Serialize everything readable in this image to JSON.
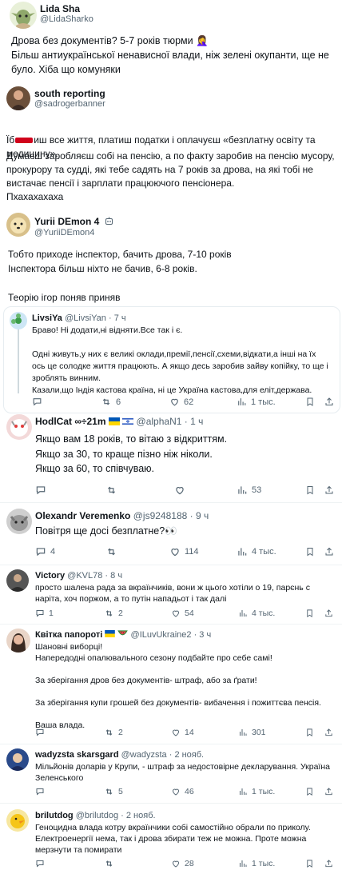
{
  "main_tweet": {
    "author_name": "Lida Sha",
    "author_handle": "@LidaSharko",
    "text": "Дрова без документів? 5-7 років тюрми 🤦‍♀️\nБільш антиукраїнської ненависної влади, ніж зелені окупанти, ще не було. Хіба що комуняки"
  },
  "quote_1": {
    "author_name": "south reporting",
    "author_handle": "@sadrogerbanner",
    "text_prefix": "Їб",
    "text_after_redact": "иш все життя, платиш податки і оплачуєш «безплатну освіту та медицину».",
    "text_rest": "Думаєш заробляєш собі на пенсію, а по факту заробив на пенсію мусору, прокурору та судді, які тебе садять на 7 років за дрова, на які тобі не вистачає пенсії і зарплати працюючого пенсіонера.\nПхахахахаха"
  },
  "quote_2": {
    "author_name": "Yurii DEmon 4",
    "author_handle": "@YuriiDEmon4",
    "text": "Тобто приходе інспектор, бачить дрова, 7-10 років\nІнспектора більш ніхто не бачив, 6-8 років.\n\nТеорію ігор поняв приняв"
  },
  "replies": [
    {
      "author_name": "LivsiYa",
      "author_handle": "@LivsiYan",
      "time": "· 7 ч",
      "text": "Браво! Ні додати,ні відняти.Все так і є.\n\nОдні живуть,у них є великі оклади,премії,пенсії,схеми,відкати,а інші на їх ось це солодке життя працюють. А якщо десь заробив зайву копійку, то ще і зроблять винним.\nКазали,що Індія кастова країна, ні це Україна кастова,для еліт,держава.",
      "reply_count": "",
      "retweet_count": "6",
      "like_count": "62",
      "view_count": "1 тыс."
    },
    {
      "author_name": "HodlCat ∞÷21m",
      "author_handle": "@alphaN1",
      "time": "· 1 ч",
      "text": "Якщо вам 18 років, то вітаю з відкриттям.\nЯкщо за 30, то краще пізно ніж ніколи.\nЯкщо за 60, то співчуваю.",
      "reply_count": "",
      "retweet_count": "",
      "like_count": "",
      "view_count": "53"
    },
    {
      "author_name": "Olexandr Veremenko",
      "author_handle": "@js9248188",
      "time": "· 9 ч",
      "text": "Повітря ще досі безплатне?👀",
      "reply_count": "4",
      "retweet_count": "",
      "like_count": "114",
      "view_count": "4 тыс."
    },
    {
      "author_name": "Victory",
      "author_handle": "@KVL78",
      "time": "· 8 ч",
      "text": "просто шалена рада за вкраїнчиків, вони ж цього хотіли о 19, парєнь с наріта, хоч поржом, а то путін нападьот і так далі",
      "reply_count": "1",
      "retweet_count": "2",
      "like_count": "54",
      "view_count": "4 тыс."
    },
    {
      "author_name": "Квітка папороті",
      "author_handle": "@ILuvUkraine2",
      "time": "· 3 ч",
      "text": "Шановні виборці!\nНапередодні опалювального сезону подбайте про себе самі!\n\nЗа зберігання дров без документів- штраф, або за ґрати!\n\nЗа зберігання купи грошей без документів- вибачення і пожиттєва пенсія.\n\nВаша влада.",
      "reply_count": "",
      "retweet_count": "2",
      "like_count": "14",
      "view_count": "301"
    },
    {
      "author_name": "wadyzsta skarsgard",
      "author_handle": "@wadyzsta",
      "time": "· 2 нояб.",
      "text": "Мільйонів доларів у Крупи, - штраф за недостовірне декларування. Україна Зеленського",
      "reply_count": "",
      "retweet_count": "5",
      "like_count": "46",
      "view_count": "1 тыс."
    },
    {
      "author_name": "brilutdog",
      "author_handle": "@brilutdog",
      "time": "· 2 нояб.",
      "text": "Геноцидна влада котру вкраїнчики собі самостійно обрали по приколу. Електроенергії нема, так і дрова збирати теж не можна. Проте можна мерзнути та помирати",
      "reply_count": "",
      "retweet_count": "",
      "like_count": "28",
      "view_count": "1 тыс."
    }
  ],
  "colors": {
    "text": "#0f1419",
    "secondary": "#536471",
    "border": "#cfd9de",
    "separator": "#eff3f4",
    "verified": "#1d9bf0",
    "redaction": "#d0021b"
  },
  "icons": [
    "reply-icon",
    "retweet-icon",
    "like-icon",
    "views-icon",
    "bookmark-icon",
    "share-icon",
    "robot-icon",
    "ukraine-flag-icon",
    "israel-flag-icon",
    "watermelon-icon"
  ]
}
